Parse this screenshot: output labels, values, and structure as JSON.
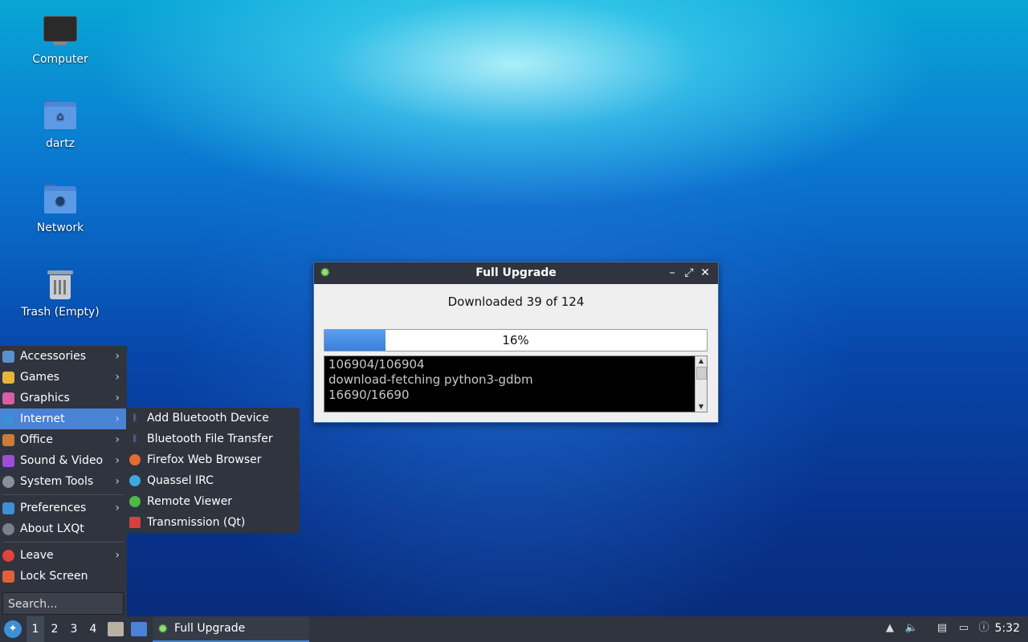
{
  "desktop": {
    "icons": [
      {
        "label": "Computer",
        "icon": "computer-icon"
      },
      {
        "label": "dartz",
        "icon": "home-folder-icon"
      },
      {
        "label": "Network",
        "icon": "network-folder-icon"
      },
      {
        "label": "Trash (Empty)",
        "icon": "trash-icon"
      }
    ]
  },
  "dialog": {
    "title": "Full Upgrade",
    "message": "Downloaded 39 of 124",
    "progress_percent": 16,
    "progress_label": "16%",
    "log_lines": [
      "106904/106904",
      "download-fetching python3-gdbm",
      "16690/16690"
    ],
    "buttons": {
      "minimize": "–",
      "maximize": "⤢",
      "close": "✕"
    }
  },
  "menu": {
    "items": [
      {
        "label": "Accessories",
        "icon": "accessories-icon",
        "color": "#5a8fd0"
      },
      {
        "label": "Games",
        "icon": "games-icon",
        "color": "#e8b53a"
      },
      {
        "label": "Graphics",
        "icon": "graphics-icon",
        "color": "#d65fa8"
      },
      {
        "label": "Internet",
        "icon": "internet-icon",
        "color": "#3d8fd6"
      },
      {
        "label": "Office",
        "icon": "office-icon",
        "color": "#c97d3a"
      },
      {
        "label": "Sound & Video",
        "icon": "sound-video-icon",
        "color": "#9c4fd6"
      },
      {
        "label": "System Tools",
        "icon": "system-tools-icon",
        "color": "#8a8f99"
      },
      {
        "label": "Preferences",
        "icon": "preferences-icon",
        "color": "#3d8fd6"
      },
      {
        "label": "About LXQt",
        "icon": "info-icon",
        "color": "#7a7f88"
      },
      {
        "label": "Leave",
        "icon": "power-icon",
        "color": "#e0443a"
      },
      {
        "label": "Lock Screen",
        "icon": "lock-icon",
        "color": "#e0603a"
      }
    ],
    "search_placeholder": "Search..."
  },
  "submenu": {
    "items": [
      {
        "label": "Add Bluetooth Device",
        "icon": "bluetooth-icon"
      },
      {
        "label": "Bluetooth File Transfer",
        "icon": "bluetooth-icon"
      },
      {
        "label": "Firefox Web Browser",
        "icon": "firefox-icon"
      },
      {
        "label": "Quassel IRC",
        "icon": "quassel-icon"
      },
      {
        "label": "Remote Viewer",
        "icon": "remote-viewer-icon"
      },
      {
        "label": "Transmission (Qt)",
        "icon": "transmission-icon"
      }
    ]
  },
  "taskbar": {
    "desktops": [
      "1",
      "2",
      "3",
      "4"
    ],
    "active_desktop": "1",
    "task_label": "Full Upgrade",
    "clock": "5:32"
  }
}
